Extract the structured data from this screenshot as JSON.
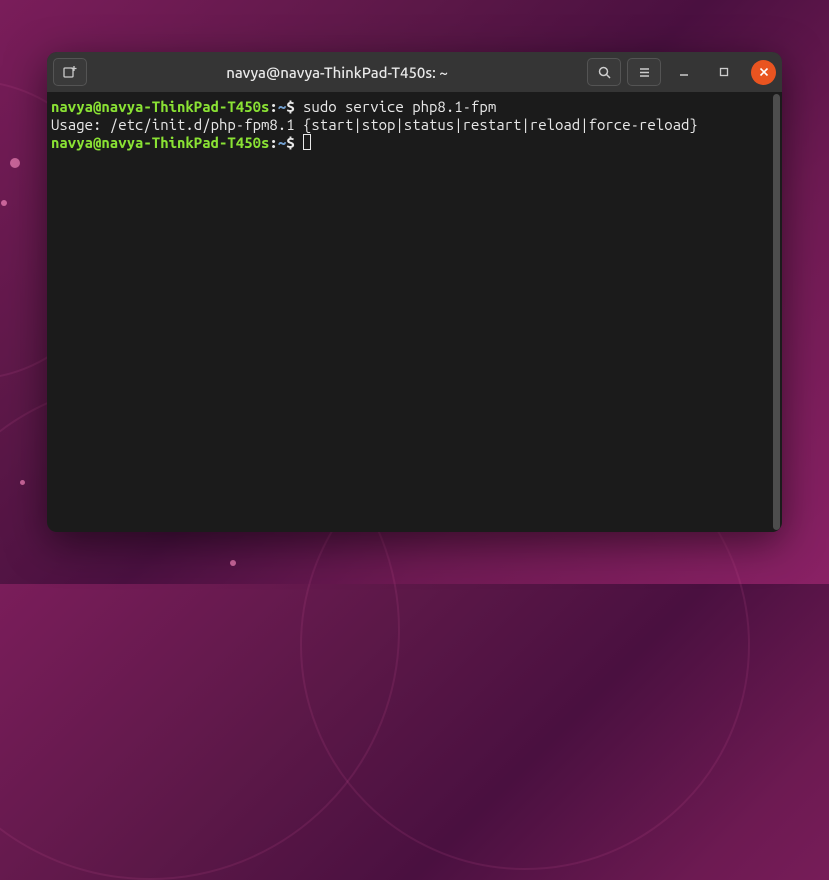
{
  "titlebar": {
    "title": "navya@navya-ThinkPad-T450s: ~"
  },
  "prompt": {
    "user_host": "navya@navya-ThinkPad-T450s",
    "separator": ":",
    "path": "~",
    "symbol": "$"
  },
  "lines": {
    "command1": "sudo service php8.1-fpm",
    "output1": "Usage: /etc/init.d/php-fpm8.1 {start|stop|status|restart|reload|force-reload}"
  },
  "colors": {
    "prompt_user": "#8ae234",
    "prompt_path": "#729fcf",
    "terminal_bg": "#1b1b1b",
    "close_btn": "#e95420"
  }
}
